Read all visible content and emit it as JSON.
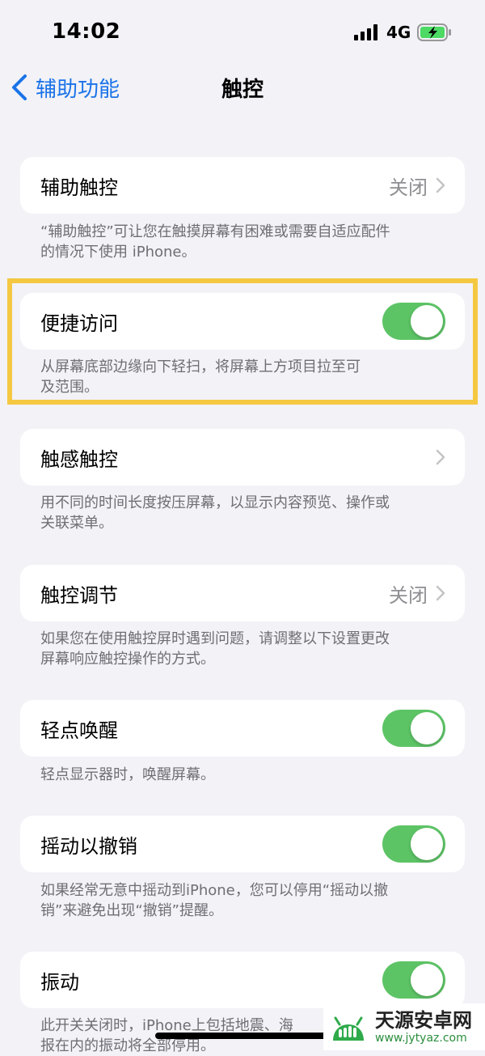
{
  "status_bar": {
    "time": "14:02",
    "network": "4G"
  },
  "nav": {
    "back_label": "辅助功能",
    "title": "触控"
  },
  "rows": [
    {
      "label": "辅助触控",
      "value": "关闭",
      "note_lines": [
        "“辅助触控”可让您在触摸屏幕有困难或需要自适应配件",
        "的情况下使用 iPhone。"
      ]
    },
    {
      "label": "便捷访问",
      "toggle": true,
      "note_lines": [
        "从屏幕底部边缘向下轻扫，将屏幕上方项目拉至可",
        "及范围。"
      ]
    },
    {
      "label": "触感触控",
      "value": "",
      "note_lines": [
        "用不同的时间长度按压屏幕，以显示内容预览、操作或",
        "关联菜单。"
      ]
    },
    {
      "label": "触控调节",
      "value": "关闭",
      "note_lines": [
        "如果您在使用触控屏时遇到问题，请调整以下设置更改",
        "屏幕响应触控操作的方式。"
      ]
    },
    {
      "label": "轻点唤醒",
      "toggle": true,
      "note_lines": [
        "轻点显示器时，唤醒屏幕。"
      ]
    },
    {
      "label": "摇动以撤销",
      "toggle": true,
      "note_lines": [
        "如果经常无意中摇动到iPhone，您可以停用“摇动以撤",
        "销”来避免出现“撤销”提醒。"
      ]
    },
    {
      "label": "振动",
      "toggle": true,
      "note_lines": [
        "此开关关闭时，iPhone上包括地震、海",
        "报在内的振动将全部停用。"
      ]
    }
  ],
  "watermark": {
    "name": "天源安卓网",
    "url": "www.jytyaz.com"
  },
  "colors": {
    "accent": "#1a73e8",
    "toggle_on": "#5dc466",
    "highlight": "#f5c842"
  }
}
